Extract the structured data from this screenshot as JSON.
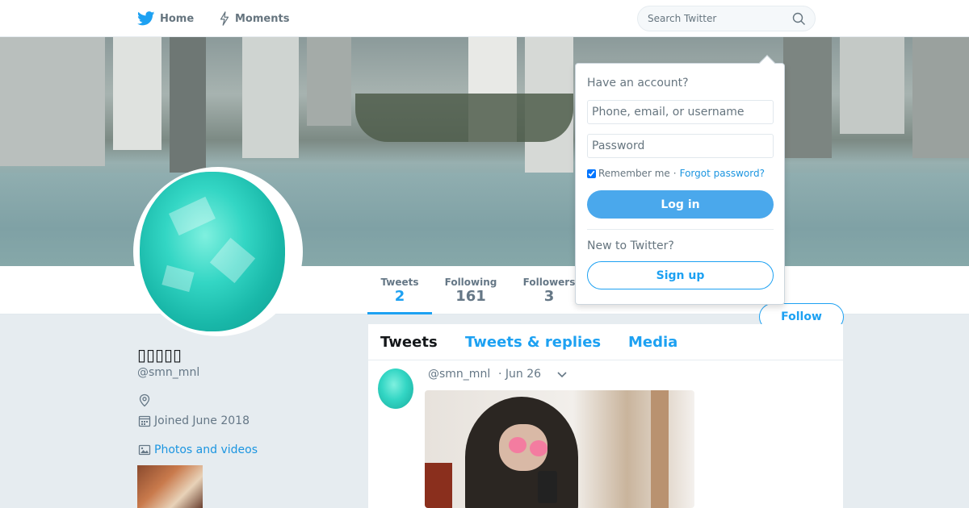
{
  "nav": {
    "home_label": "Home",
    "moments_label": "Moments",
    "search_placeholder": "Search Twitter"
  },
  "colors": {
    "brand": "#1da1f2",
    "background": "#e6ecf0"
  },
  "stats": {
    "tweets_label": "Tweets",
    "tweets_value": "2",
    "following_label": "Following",
    "following_value": "161",
    "followers_label": "Followers",
    "followers_value": "3"
  },
  "follow_label": "Follow",
  "profile": {
    "name": "▯▯▯▯▯",
    "handle": "@smn_mnl",
    "joined": "Joined June 2018",
    "photos_label": "Photos and videos"
  },
  "timeline": {
    "tabs": [
      "Tweets",
      "Tweets & replies",
      "Media"
    ],
    "tweet": {
      "handle": "@smn_mnl",
      "date": "· Jun 26"
    }
  },
  "login": {
    "have_account": "Have an account?",
    "username_placeholder": "Phone, email, or username",
    "password_placeholder": "Password",
    "remember_label": "Remember me",
    "separator": "·",
    "forgot_label": "Forgot password?",
    "login_label": "Log in",
    "new_label": "New to Twitter?",
    "signup_label": "Sign up"
  },
  "icons": [
    "twitter-bird-icon",
    "lightning-icon",
    "search-icon",
    "location-icon",
    "calendar-icon",
    "image-icon",
    "chevron-down-icon"
  ]
}
